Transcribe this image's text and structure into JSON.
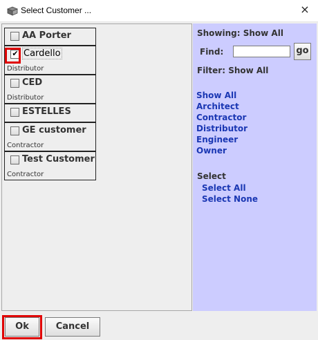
{
  "window": {
    "title": "Select Customer ...",
    "close_icon": "×",
    "app_icon": "dialog-box-icon"
  },
  "customers": [
    {
      "name": "AA Porter",
      "type": "",
      "checked": false
    },
    {
      "name": "Cardello",
      "type": "Distributor",
      "checked": true
    },
    {
      "name": "CED",
      "type": "Distributor",
      "checked": false
    },
    {
      "name": "ESTELLES",
      "type": "",
      "checked": false
    },
    {
      "name": "GE customer",
      "type": "Contractor",
      "checked": false
    },
    {
      "name": "Test Customer",
      "type": "Contractor",
      "checked": false
    }
  ],
  "checkmark_glyph": "✔",
  "right_panel": {
    "showing_label": "Showing: Show All",
    "find_label": "Find:",
    "find_value": "",
    "go_label": "go",
    "filter_label": "Filter: Show All",
    "filters": [
      "Show All",
      "Architect",
      "Contractor",
      "Distributor",
      "Engineer",
      "Owner"
    ],
    "select_heading": "Select",
    "select_all": "Select All",
    "select_none": "Select None"
  },
  "footer": {
    "ok_label": "Ok",
    "cancel_label": "Cancel"
  },
  "colors": {
    "right_panel_bg": "#ccccff",
    "link": "#1a37b3",
    "highlight": "#e00000"
  }
}
